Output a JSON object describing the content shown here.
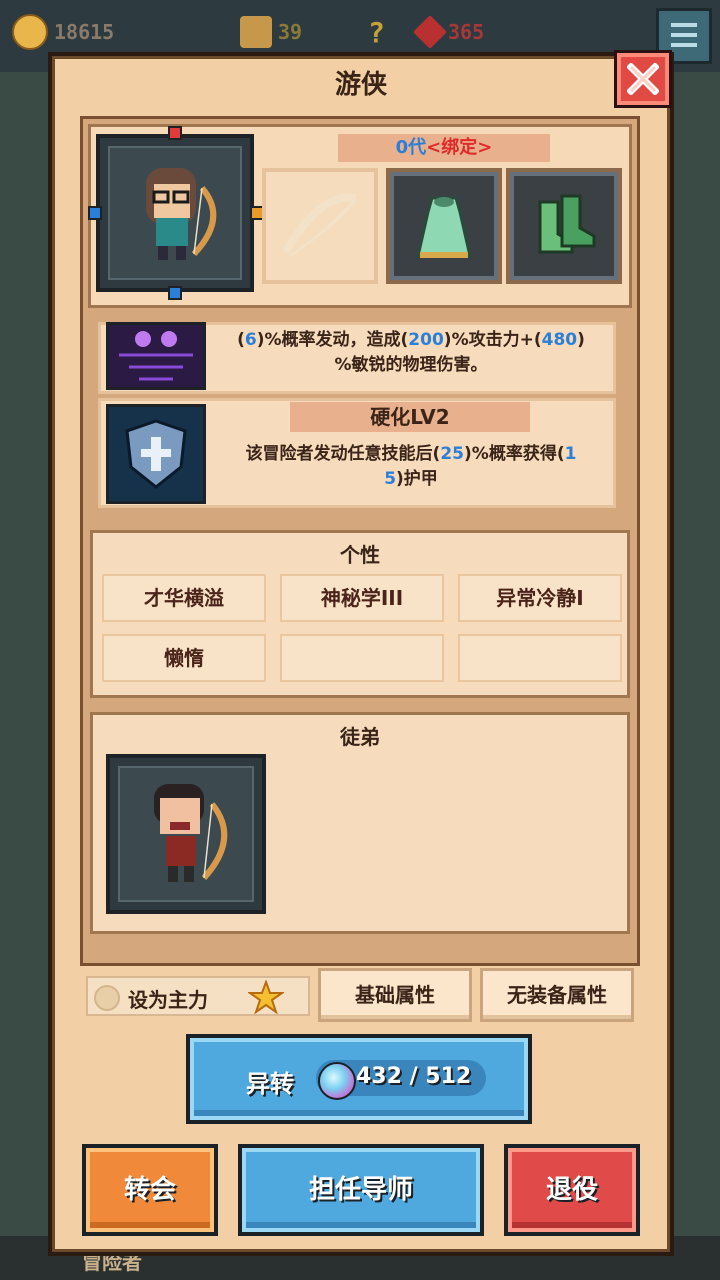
{
  "resources": [
    {
      "icon": "gold-coin-icon",
      "value": "18615",
      "color": "#e8b64a"
    },
    {
      "icon": "hammer-icon",
      "value": "39",
      "color": "#d8a84a"
    },
    {
      "icon": "question-icon",
      "value": "?",
      "color": "#e8c24a"
    },
    {
      "icon": "ruby-icon",
      "value": "365",
      "color": "#d84040"
    }
  ],
  "dialog": {
    "title": "游侠",
    "generation_number": "0代",
    "generation_tag": "<绑定>"
  },
  "equipment": [
    {
      "name": "bow-slot",
      "state": "empty"
    },
    {
      "name": "cloak-armor",
      "state": "equipped"
    },
    {
      "name": "green-boots",
      "state": "equipped"
    }
  ],
  "skills": [
    {
      "segments": [
        "(",
        "6",
        ")%概率发动，造成(",
        "200",
        ")%攻击力+(",
        "480",
        ")"
      ],
      "line2": "%敏锐的物理伤害。"
    },
    {
      "name": "硬化LV2",
      "segments": [
        "该冒险者发动任意技能后(",
        "25",
        ")%概率获得(",
        "1"
      ],
      "line2_segments": [
        "5",
        ")护甲"
      ]
    }
  ],
  "traits": {
    "title": "个性",
    "items": [
      "才华横溢",
      "神秘学III",
      "异常冷静I",
      "懒惰",
      "",
      ""
    ]
  },
  "disciples": {
    "title": "徒弟"
  },
  "actions": {
    "set_main": "设为主力",
    "base_stats": "基础属性",
    "no_equip_stats": "无装备属性",
    "transform": "异转",
    "transform_cost": "432 / 512",
    "guild": "转会",
    "mentor": "担任导师",
    "retire": "退役"
  },
  "background": {
    "bottom_label": "冒险者"
  },
  "colors": {
    "number_blue": "#2a7fd8",
    "tag_red": "#e02a2a",
    "button_blue": "#4fa8de",
    "button_orange": "#f08a3a",
    "button_red": "#e04a48"
  }
}
